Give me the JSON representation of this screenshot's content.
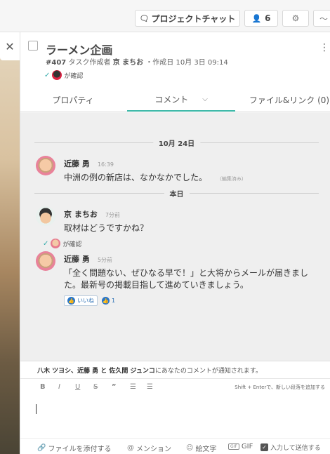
{
  "topbar": {
    "project_chat_label": "プロジェクトチャット",
    "member_count": "6"
  },
  "task": {
    "title": "ラーメン企画",
    "meta_number": "#407",
    "meta_created_by_label": "タスク作成者",
    "meta_creator": "京 まちお",
    "meta_created_date": "・作成日 10月 3日 09:14",
    "confirmed_label": "が確認"
  },
  "tabs": {
    "properties": "プロパティ",
    "comment": "コメント",
    "files_links": "ファイル&リンク (0)"
  },
  "comments": {
    "date_divider_1": "10月 24日",
    "date_divider_2": "本日",
    "items": [
      {
        "author": "近藤 勇",
        "time": "16:39",
        "text": "中洲の例の新店は、なかなかでした。",
        "edited": "（編集済み）"
      },
      {
        "author": "京 まちお",
        "time": "7分前",
        "text": "取材はどうですかね？",
        "confirmed": "が確認"
      },
      {
        "author": "近藤 勇",
        "time": "5分前",
        "text": "「全く問題ない、ぜひなる早で！」と大将からメールが届きました。最新号の掲載目指して進めていきましょう。",
        "like_label": "いいね",
        "like_count": "1"
      }
    ]
  },
  "notice": {
    "names": "八木 ツヨシ、近藤 勇 と 佐久間 ジュンコ",
    "suffix": "にあなたのコメントが通知されます。"
  },
  "editor": {
    "tools": [
      "B",
      "I",
      "U",
      "S",
      "”",
      "☰",
      "☰"
    ],
    "hint": "Shift + Enterで、新しい段落を追加する",
    "attach_file": "ファイルを添付する",
    "mention": "メンション",
    "emoji": "絵文字",
    "gif": "GIF",
    "submit_on_enter": "入力して送信する"
  }
}
